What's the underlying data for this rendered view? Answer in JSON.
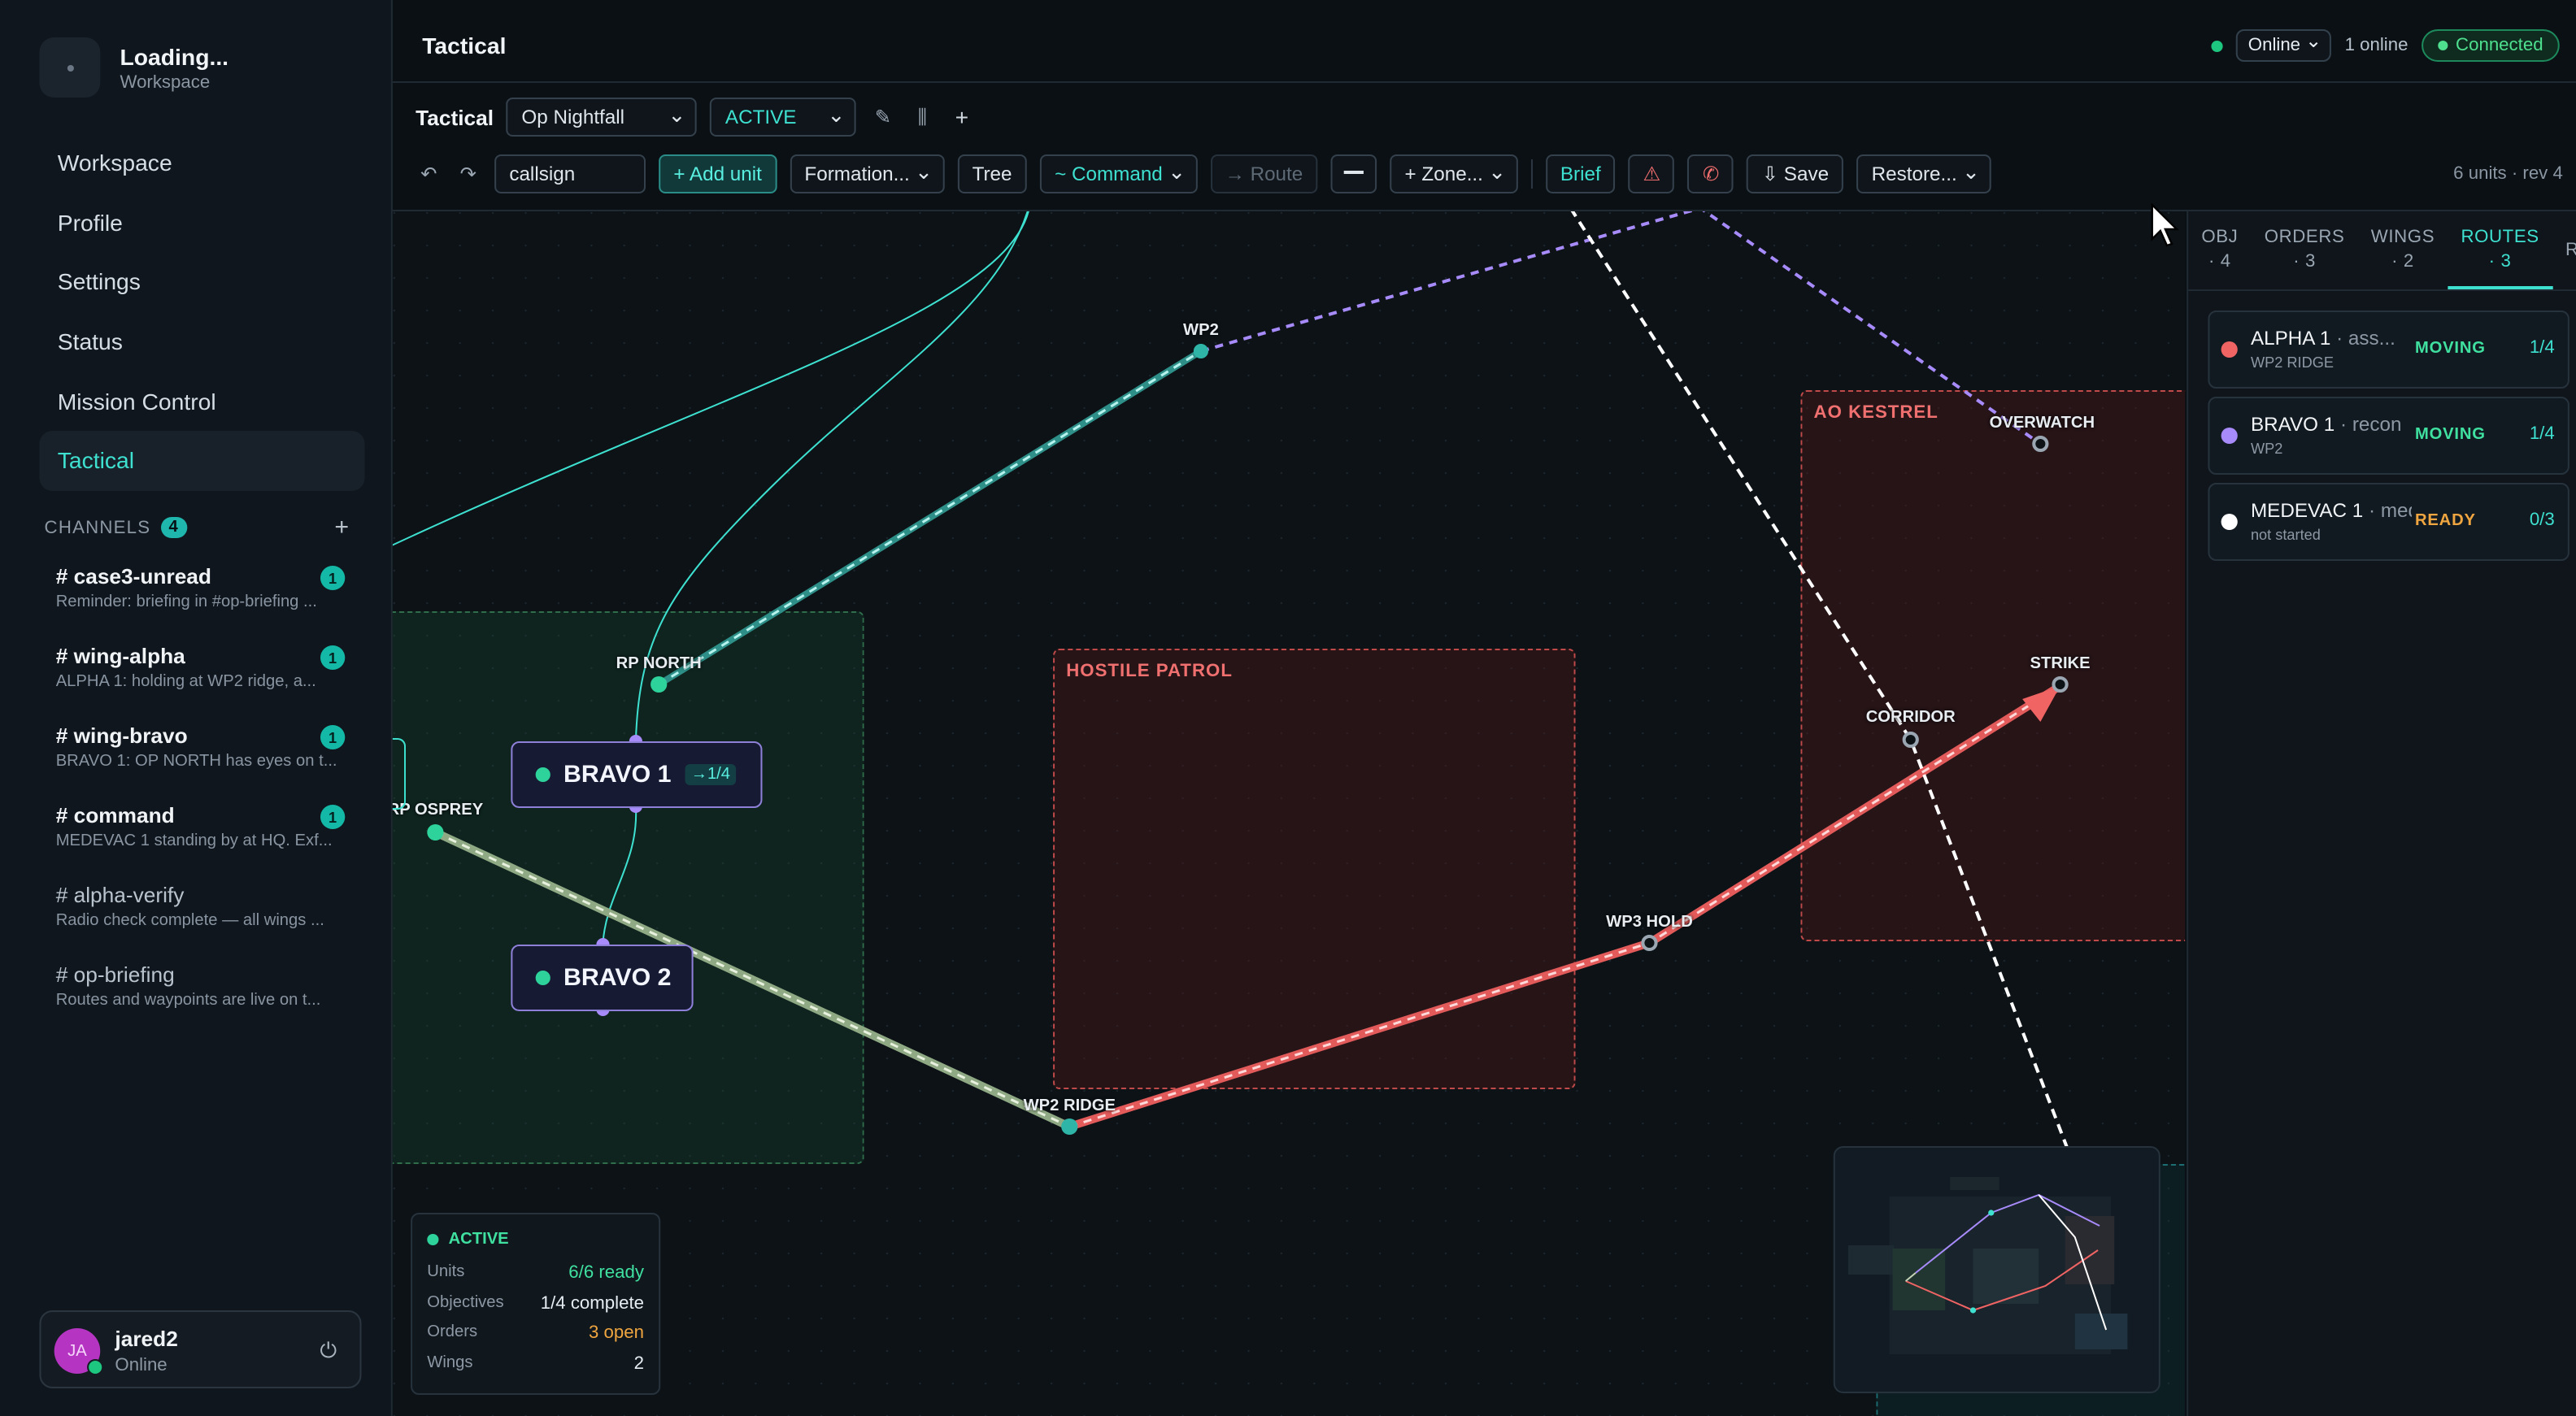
{
  "workspace": {
    "title": "Loading...",
    "subtitle": "Workspace"
  },
  "nav": [
    "Workspace",
    "Profile",
    "Settings",
    "Status",
    "Mission Control",
    "Tactical"
  ],
  "channels_header": {
    "label": "CHANNELS",
    "count": "4",
    "add": "+"
  },
  "channels": [
    {
      "name": "# case3-unread",
      "preview": "Reminder: briefing in #op-briefing ...",
      "badge": "1"
    },
    {
      "name": "# wing-alpha",
      "preview": "ALPHA 1: holding at WP2 ridge, a...",
      "badge": "1"
    },
    {
      "name": "# wing-bravo",
      "preview": "BRAVO 1: OP NORTH has eyes on t...",
      "badge": "1"
    },
    {
      "name": "# command",
      "preview": "MEDEVAC 1 standing by at HQ. Exf...",
      "badge": "1"
    },
    {
      "name": "# alpha-verify",
      "preview": "Radio check complete — all wings ..."
    },
    {
      "name": "# op-briefing",
      "preview": "Routes and waypoints are live on t..."
    }
  ],
  "user": {
    "initials": "JA",
    "name": "jared2",
    "status": "Online"
  },
  "header": {
    "title": "Tactical",
    "presence": "Online",
    "online_count": "1 online",
    "connection": "Connected"
  },
  "toolbar": {
    "label": "Tactical",
    "operation": "Op Nightfall",
    "state": "ACTIVE",
    "undo": "↶",
    "redo": "↷",
    "callsign_value": "callsign",
    "add_unit": "+ Add unit",
    "formation": "Formation...",
    "tree": "Tree",
    "command": "~ Command",
    "route": "→ Route",
    "zone": "+ Zone...",
    "brief": "Brief",
    "save": "⇩ Save",
    "restore": "Restore...",
    "stats": "6 units · rev 4"
  },
  "map": {
    "zones": [
      "HOSTILE PATROL",
      "AO KESTREL"
    ],
    "waypoints": [
      "WP2",
      "OVERWATCH",
      "RP NORTH",
      "RP OSPREY",
      "STRIKE",
      "CORRIDOR",
      "WP3 HOLD",
      "WP2 RIDGE"
    ],
    "units": [
      {
        "name": "BRAVO 1",
        "progress": "→1/4"
      },
      {
        "name": "BRAVO 2"
      }
    ],
    "colors": {
      "alpha": "#f06464",
      "bravo": "#a78bfa",
      "medevac": "#ffffff",
      "link": "#3ee0d0"
    }
  },
  "status_card": {
    "state": "ACTIVE",
    "rows": [
      {
        "label": "Units",
        "value": "6/6 ready"
      },
      {
        "label": "Objectives",
        "value": "1/4 complete"
      },
      {
        "label": "Orders",
        "value": "3 open"
      },
      {
        "label": "Wings",
        "value": "2"
      }
    ]
  },
  "panel": {
    "tabs": [
      {
        "label": "OBJ",
        "count": "· 4"
      },
      {
        "label": "ORDERS",
        "count": "· 3"
      },
      {
        "label": "WINGS",
        "count": "· 2"
      },
      {
        "label": "ROUTES",
        "count": "· 3"
      },
      {
        "label": "ROL",
        "count": ""
      }
    ],
    "routes": [
      {
        "name": "ALPHA 1",
        "role": " · ass...",
        "sub": "WP2 RIDGE",
        "state": "MOVING",
        "progress": "1/4",
        "color": "#f06464"
      },
      {
        "name": "BRAVO 1",
        "role": " · recon",
        "sub": "WP2",
        "state": "MOVING",
        "progress": "1/4",
        "color": "#a78bfa"
      },
      {
        "name": "MEDEVAC 1",
        "role": " · medical",
        "sub": "not started",
        "state": "READY",
        "progress": "0/3",
        "color": "#ffffff"
      }
    ]
  }
}
